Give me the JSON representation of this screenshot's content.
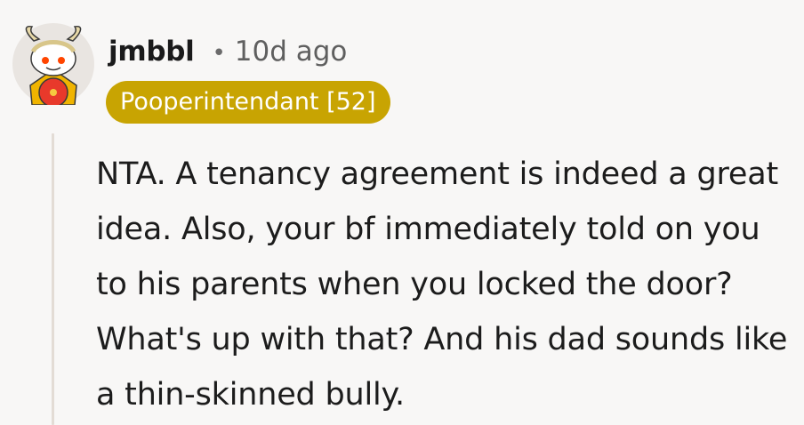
{
  "comment": {
    "username": "jmbbl",
    "separator": "•",
    "age": "10d ago",
    "flair": "Pooperintendant [52]",
    "body": "NTA. A tenancy agreement is indeed a great idea. Also, your bf immediately told on you to his parents when you locked the door? What's up with that? And his dad sounds like a thin-skinned bully.",
    "avatar_icon": "snoo-avatar-icon"
  },
  "colors": {
    "background": "#f8f7f6",
    "flair_bg": "#c8a402",
    "flair_text": "#ffffff",
    "thread_line": "#e3dcd5"
  }
}
